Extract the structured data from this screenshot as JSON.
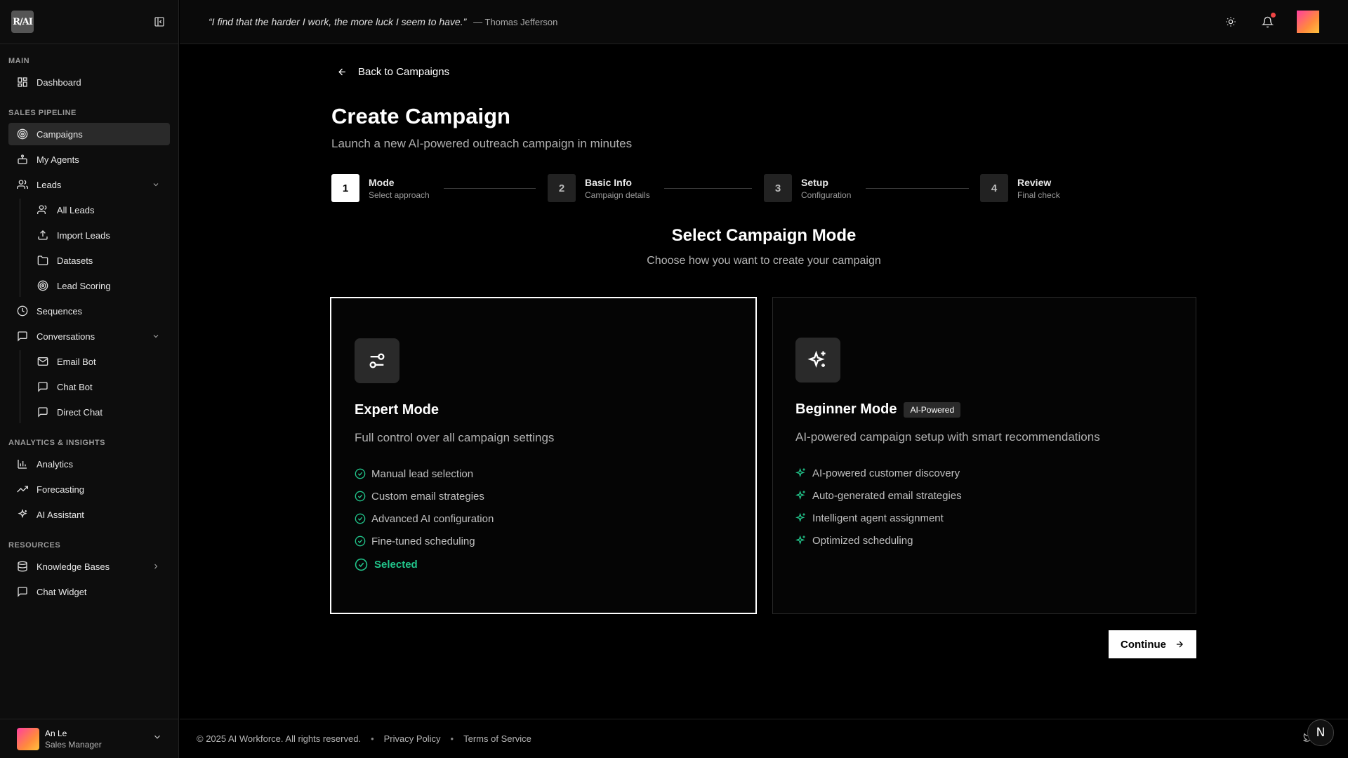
{
  "app": {
    "logo_text": "R/AI"
  },
  "header": {
    "quote": "“I find that the harder I work, the more luck I seem to have.”",
    "quote_author": "— Thomas Jefferson"
  },
  "sidebar": {
    "sections": {
      "main": "MAIN",
      "pipeline": "SALES PIPELINE",
      "analytics": "ANALYTICS & INSIGHTS",
      "resources": "RESOURCES"
    },
    "items": {
      "dashboard": "Dashboard",
      "campaigns": "Campaigns",
      "my_agents": "My Agents",
      "leads": "Leads",
      "all_leads": "All Leads",
      "import_leads": "Import Leads",
      "datasets": "Datasets",
      "lead_scoring": "Lead Scoring",
      "sequences": "Sequences",
      "conversations": "Conversations",
      "email_bot": "Email Bot",
      "chat_bot": "Chat Bot",
      "direct_chat": "Direct Chat",
      "analytics": "Analytics",
      "forecasting": "Forecasting",
      "ai_assistant": "AI Assistant",
      "knowledge_bases": "Knowledge Bases",
      "chat_widget": "Chat Widget"
    },
    "active_item": "campaigns",
    "user": {
      "name": "An Le",
      "role": "Sales Manager"
    }
  },
  "main": {
    "back_label": "Back to Campaigns",
    "title": "Create Campaign",
    "subtitle": "Launch a new AI-powered outreach campaign in minutes",
    "steps": [
      {
        "num": "1",
        "title": "Mode",
        "sub": "Select approach",
        "active": true
      },
      {
        "num": "2",
        "title": "Basic Info",
        "sub": "Campaign details",
        "active": false
      },
      {
        "num": "3",
        "title": "Setup",
        "sub": "Configuration",
        "active": false
      },
      {
        "num": "4",
        "title": "Review",
        "sub": "Final check",
        "active": false
      }
    ],
    "section_title": "Select Campaign Mode",
    "section_subtitle": "Choose how you want to create your campaign",
    "cards": [
      {
        "title": "Expert Mode",
        "badge": "",
        "desc": "Full control over all campaign settings",
        "features": [
          "Manual lead selection",
          "Custom email strategies",
          "Advanced AI configuration",
          "Fine-tuned scheduling"
        ],
        "selected_label": "Selected",
        "selected": true
      },
      {
        "title": "Beginner Mode",
        "badge": "AI-Powered",
        "desc": "AI-powered campaign setup with smart recommendations",
        "features": [
          "AI-powered customer discovery",
          "Auto-generated email strategies",
          "Intelligent agent assignment",
          "Optimized scheduling"
        ],
        "selected": false
      }
    ],
    "continue_label": "Continue"
  },
  "footer": {
    "copyright": "© 2025 AI Workforce. All rights reserved.",
    "privacy": "Privacy Policy",
    "terms": "Terms of Service",
    "n_button": "N"
  },
  "colors": {
    "accent_green": "#22c58b",
    "notification": "#ef4444",
    "active_bg": "#2a2a2a"
  },
  "icons": {
    "selected_feature": "check-circle-icon",
    "ai_feature": "sparkles-icon"
  }
}
